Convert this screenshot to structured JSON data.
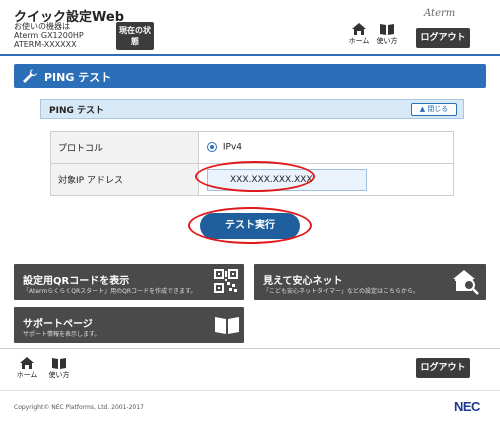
{
  "header": {
    "app_title": "クイック設定Web",
    "device_caption": "お使いの機器は",
    "device_model": "Aterm GX1200HP",
    "device_name": "ATERM-XXXXXX",
    "status_button": "現在の状態",
    "brand": "Aterm",
    "home_label": "ホーム",
    "help_label": "使い方",
    "logout_label": "ログアウト"
  },
  "section": {
    "title": "PING テスト"
  },
  "panel": {
    "title": "PING テスト",
    "close_label": "閉じる"
  },
  "form": {
    "protocol_label": "プロトコル",
    "protocol_value": "IPv4",
    "target_label": "対象IP アドレス",
    "target_value": "XXX.XXX.XXX.XXX"
  },
  "actions": {
    "test_button": "テスト実行"
  },
  "tiles": {
    "qr_title": "設定用QRコードを表示",
    "qr_sub": "「AtermらくらくQRスタート」用のQRコードを作成できます。",
    "safety_title": "見えて安心ネット",
    "safety_sub": "「こども安心ネットタイマー」などの設定はこちらから。",
    "support_title": "サポートページ",
    "support_sub": "サポート情報を表示します。"
  },
  "footer": {
    "home_label": "ホーム",
    "help_label": "使い方",
    "logout_label": "ログアウト",
    "copyright": "Copyright© NEC Platforms, Ltd. 2001-2017",
    "logo": "NEC"
  },
  "colors": {
    "accent": "#2a6fb8",
    "highlight": "#e0191b",
    "tile": "#4a4a4a"
  }
}
